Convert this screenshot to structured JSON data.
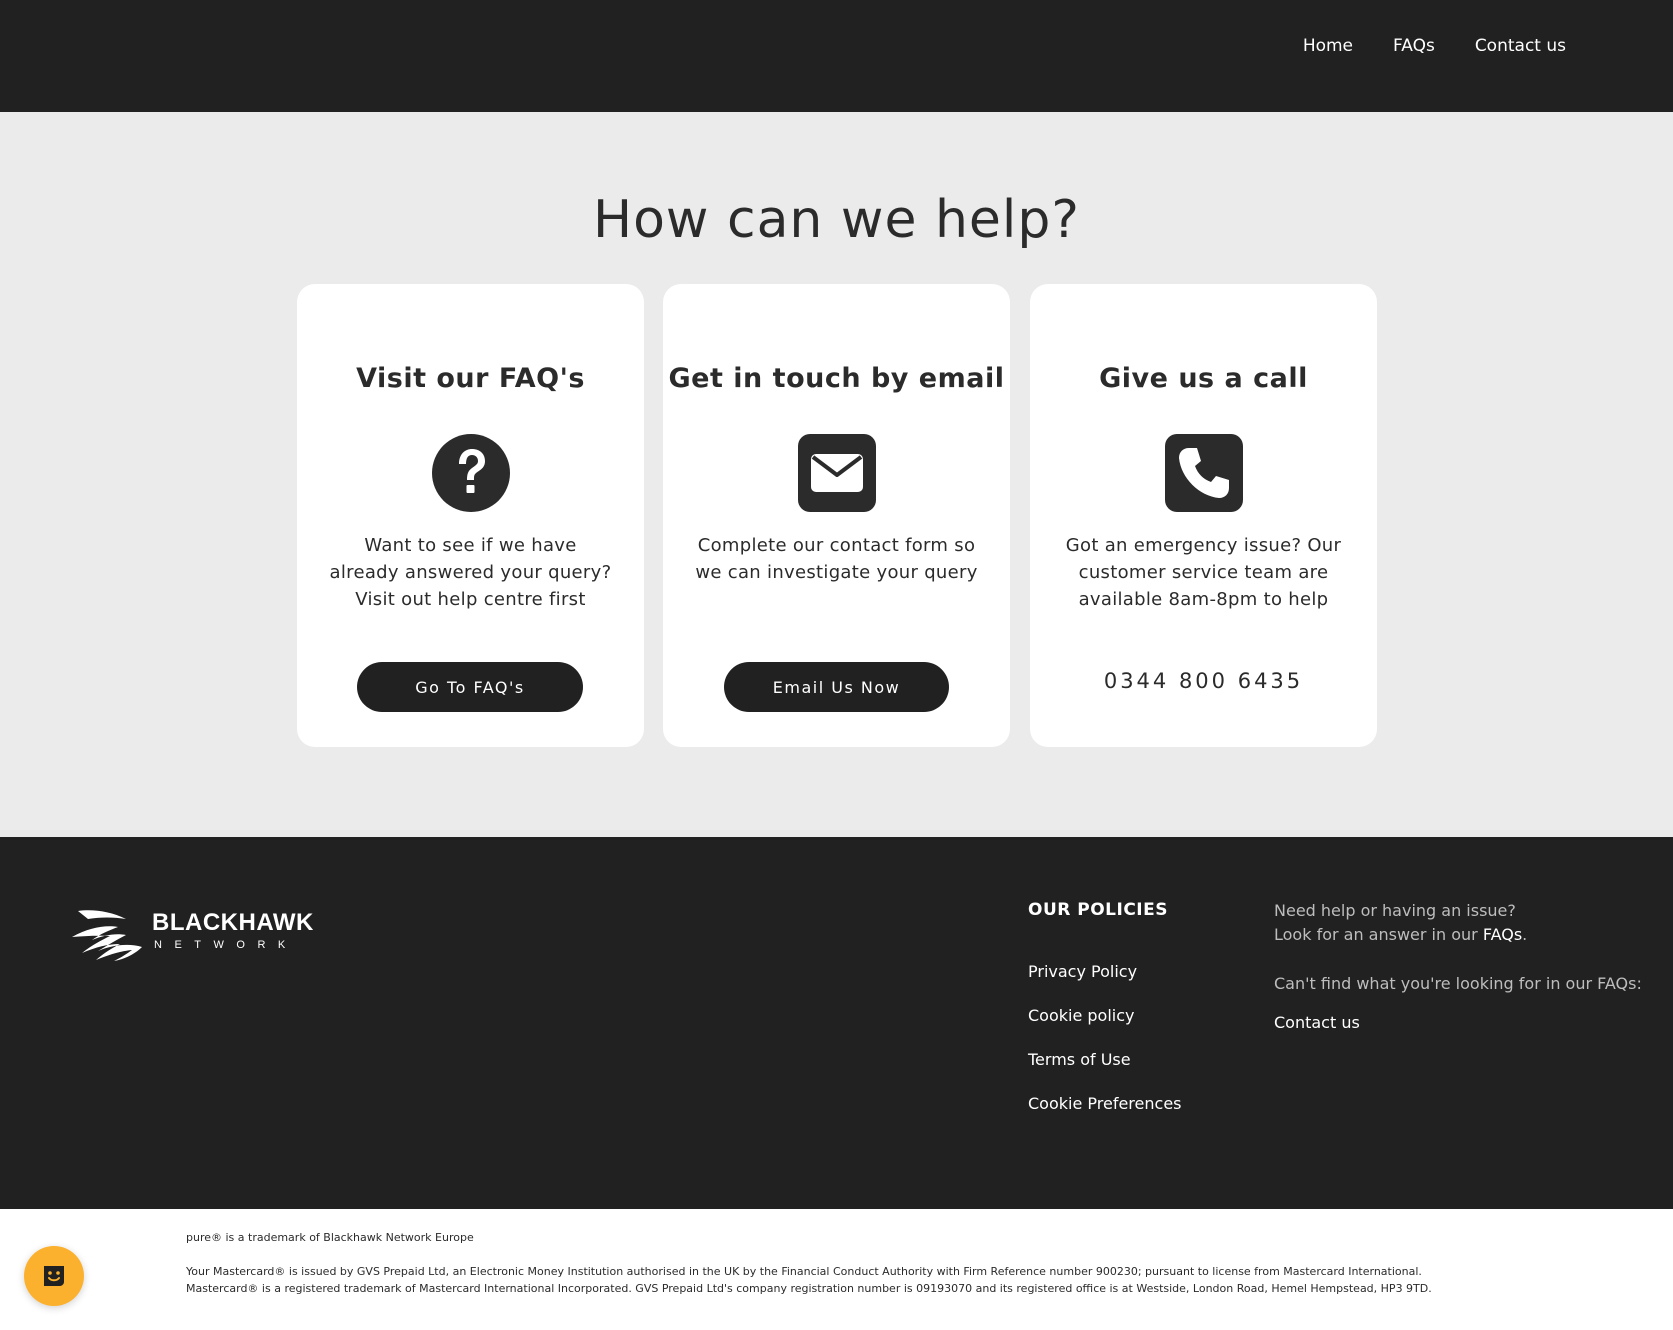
{
  "header": {
    "nav": {
      "home": "Home",
      "faqs": "FAQs",
      "contact": "Contact us"
    }
  },
  "main": {
    "title": "How can we help?",
    "cards": [
      {
        "title": "Visit our FAQ's",
        "icon": "question-circle-icon",
        "text": "Want to see if we have already answered your query? Visit out help centre first",
        "button": "Go To FAQ's"
      },
      {
        "title": "Get in touch by email",
        "icon": "envelope-icon",
        "text": "Complete our contact form so we can investigate your query",
        "button": "Email Us Now"
      },
      {
        "title": "Give us a call",
        "icon": "phone-icon",
        "text": "Got an emergency issue? Our customer service team are available 8am-8pm to help",
        "phone": "0344 800 6435"
      }
    ]
  },
  "footer": {
    "logo": {
      "name": "BLACKHAWK",
      "sub": "NETWORK"
    },
    "policies": {
      "heading": "OUR POLICIES",
      "links": [
        "Privacy Policy",
        "Cookie policy",
        "Terms of Use",
        "Cookie Preferences"
      ]
    },
    "help": {
      "line1": "Need help or having an issue?",
      "line2_prefix": "Look for an answer in our ",
      "line2_link": "FAQs",
      "line2_suffix": ".",
      "cant_find": "Can't find what you're looking for in our FAQs:",
      "contact_link": "Contact us"
    }
  },
  "legal": {
    "trademark": "pure® is a trademark of Blackhawk Network Europe",
    "mastercard": "Your Mastercard® is issued by GVS Prepaid Ltd, an Electronic Money Institution authorised in the UK by the Financial Conduct Authority with Firm Reference number 900230; pursuant to license from Mastercard International. Mastercard® is a registered trademark of Mastercard International Incorporated. GVS Prepaid Ltd's company registration number is 09193070 and its registered office is at Westside, London Road, Hemel Hempstead, HP3 9TD."
  },
  "chat": {
    "icon": "chat-smiley-icon",
    "color": "#fbb12e"
  },
  "colors": {
    "dark": "#212121",
    "background": "#ebebeb",
    "text": "#2b2b2b"
  }
}
